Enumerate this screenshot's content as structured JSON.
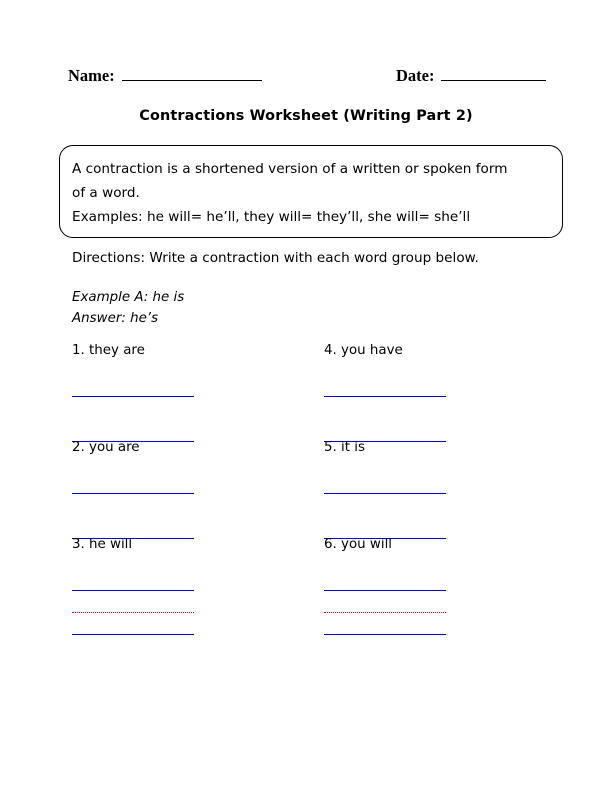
{
  "header": {
    "name_label": "Name:",
    "date_label": "Date:"
  },
  "title": "Contractions Worksheet (Writing Part 2)",
  "info_box": {
    "lines": [
      "A contraction is a shortened version of a written or spoken form",
      "of a word.",
      "Examples: he will= he’ll, they will= they’ll, she will= she’ll"
    ]
  },
  "directions": "Directions: Write a contraction with each word group below.",
  "example": {
    "prompt": "Example A: he is",
    "answer": "Answer: he’s"
  },
  "questions": [
    {
      "number": "1.",
      "text": "they are",
      "label": "1. they are",
      "lines": "wide"
    },
    {
      "number": "4.",
      "text": "you have",
      "label": "4. you have",
      "lines": "wide"
    },
    {
      "number": "2.",
      "text": "you are",
      "label": "2. you are",
      "lines": "wide"
    },
    {
      "number": "5.",
      "text": "it is",
      "label": "5. it is",
      "lines": "wide"
    },
    {
      "number": "3.",
      "text": "he will",
      "label": "3. he will",
      "lines": "guide"
    },
    {
      "number": "6.",
      "text": "you will",
      "label": "6. you will",
      "lines": "guide"
    }
  ],
  "colors": {
    "writing_line": "#0000cc",
    "guide_line": "#cc1111",
    "text": "#000000",
    "background": "#ffffff"
  }
}
